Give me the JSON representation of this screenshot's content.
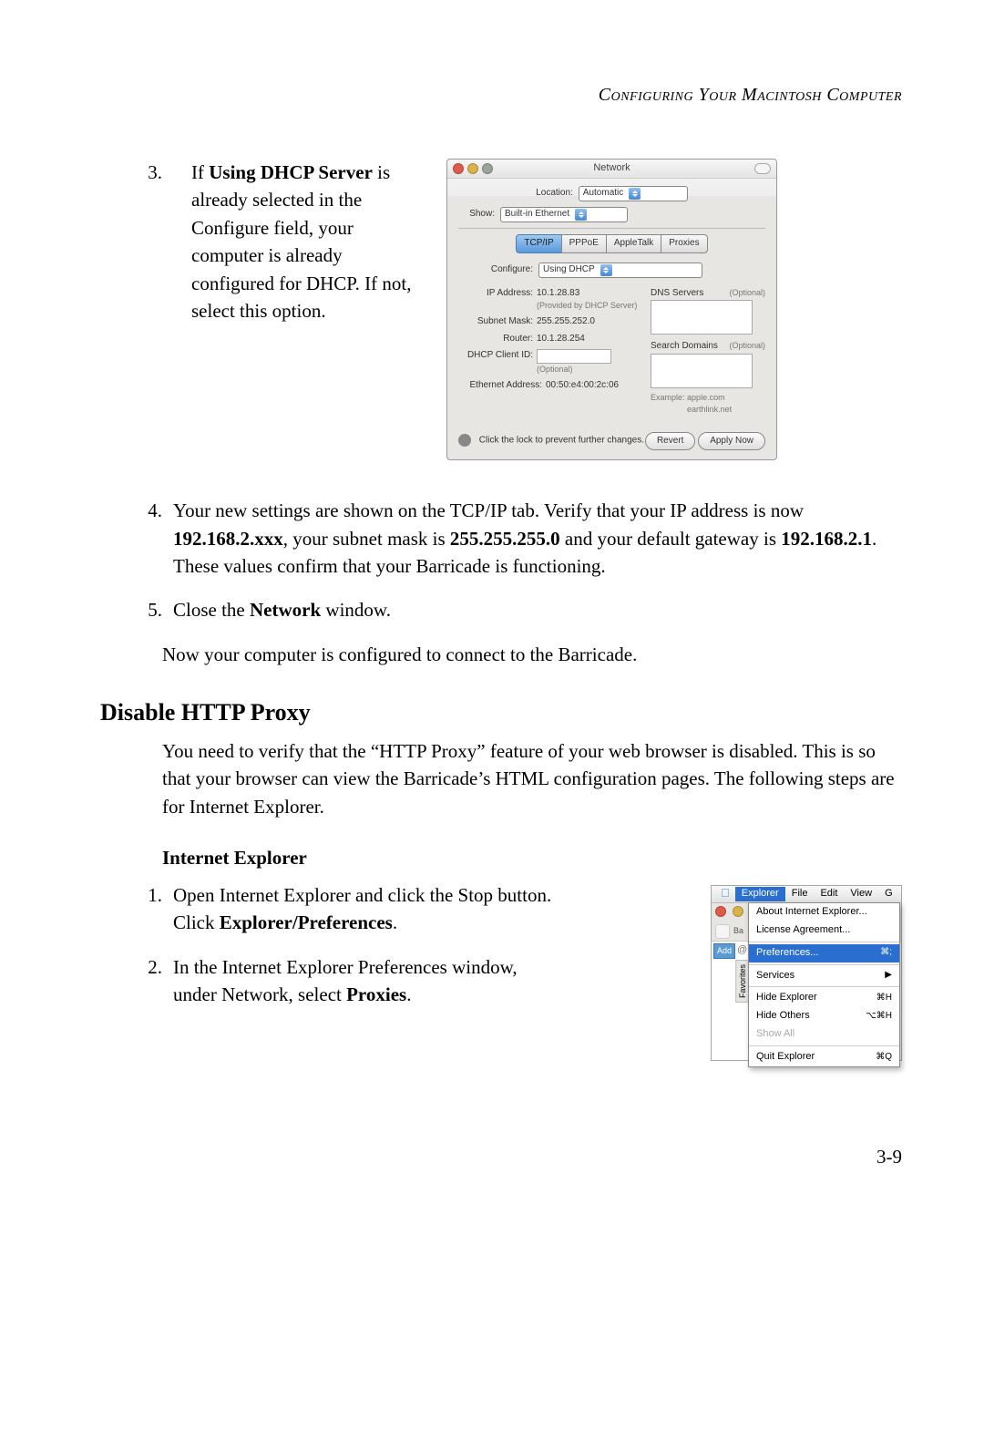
{
  "header": "Configuring Your Macintosh Computer",
  "step3": {
    "num": "3.",
    "prefix": "If ",
    "bold1": "Using DHCP Server",
    "suffix": " is already selected in the Configure field, your computer is already configured for DHCP. If not, select this option."
  },
  "networkWindow": {
    "title": "Network",
    "location_label": "Location:",
    "location_value": "Automatic",
    "show_label": "Show:",
    "show_value": "Built-in Ethernet",
    "tabs": [
      "TCP/IP",
      "PPPoE",
      "AppleTalk",
      "Proxies"
    ],
    "configure_label": "Configure:",
    "configure_value": "Using DHCP",
    "ip_label": "IP Address:",
    "ip_value": "10.1.28.83",
    "ip_note": "(Provided by DHCP Server)",
    "subnet_label": "Subnet Mask:",
    "subnet_value": "255.255.252.0",
    "router_label": "Router:",
    "router_value": "10.1.28.254",
    "dhcp_client_label": "DHCP Client ID:",
    "dhcp_client_note": "(Optional)",
    "ethernet_label": "Ethernet Address:",
    "ethernet_value": "00:50:e4:00:2c:06",
    "dns_label": "DNS Servers",
    "dns_note": "(Optional)",
    "search_label": "Search Domains",
    "search_note": "(Optional)",
    "example_label": "Example:",
    "example_value": "apple.com\nearthlink.net",
    "lock_text": "Click the lock to prevent further changes.",
    "revert_btn": "Revert",
    "apply_btn": "Apply Now"
  },
  "step4": {
    "num": "4.",
    "t1": "Your new settings are shown on the TCP/IP tab. Verify that your IP address is now ",
    "b1": "192.168.2.xxx",
    "t2": ", your subnet mask is ",
    "b2": "255.255.255.0",
    "t3": " and your default gateway is ",
    "b3": "192.168.2.1",
    "t4": ". These values confirm that your Barricade is functioning."
  },
  "step5": {
    "num": "5.",
    "t1": "Close the ",
    "b1": "Network",
    "t2": " window."
  },
  "para_now": "Now your computer is configured to connect to the Barricade.",
  "section_disable": "Disable HTTP Proxy",
  "para_disable": "You need to verify that the “HTTP Proxy” feature of your web browser is disabled. This is so that your browser can view the Barricade’s HTML configuration pages. The following steps are for Internet Explorer.",
  "sub_ie": "Internet Explorer",
  "ie1": {
    "num": "1.",
    "t1": "Open Internet Explorer and click the Stop button. Click ",
    "b1": "Explorer/Preferences",
    "t2": "."
  },
  "ie2": {
    "num": "2.",
    "t1": "In the Internet Explorer Preferences window, under Network, select ",
    "b1": "Proxies",
    "t2": "."
  },
  "explorerMenu": {
    "menubar": [
      "Explorer",
      "File",
      "Edit",
      "View",
      "G"
    ],
    "items": [
      {
        "label": "About Internet Explorer...",
        "sc": ""
      },
      {
        "label": "License Agreement...",
        "sc": ""
      },
      {
        "sep": true
      },
      {
        "label": "Preferences...",
        "sc": "⌘;",
        "hl": true
      },
      {
        "sep": true
      },
      {
        "label": "Services",
        "sc": "▶"
      },
      {
        "sep": true
      },
      {
        "label": "Hide Explorer",
        "sc": "⌘H"
      },
      {
        "label": "Hide Others",
        "sc": "⌥⌘H"
      },
      {
        "label": "Show All",
        "sc": "",
        "dis": true
      },
      {
        "sep": true
      },
      {
        "label": "Quit Explorer",
        "sc": "⌘Q"
      }
    ],
    "side_tab": "Favorites",
    "addr_fragment": "Add"
  },
  "page_num": "3-9"
}
